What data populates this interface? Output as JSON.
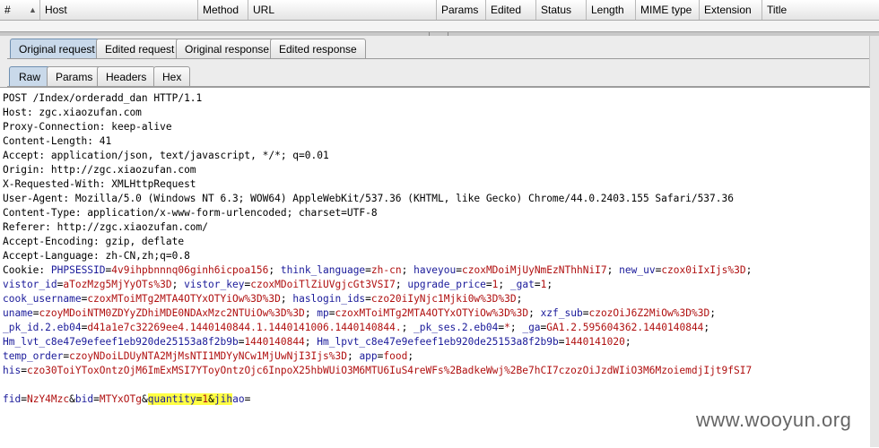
{
  "table": {
    "sort_icon": "sort-up-icon",
    "columns": [
      "#",
      "Host",
      "Method",
      "URL",
      "Params",
      "Edited",
      "Status",
      "Length",
      "MIME type",
      "Extension",
      "Title"
    ]
  },
  "outer_tabs": [
    "Original request",
    "Edited request",
    "Original response",
    "Edited response"
  ],
  "inner_tabs": [
    "Raw",
    "Params",
    "Headers",
    "Hex"
  ],
  "request": {
    "request_line": "POST /Index/orderadd_dan HTTP/1.1",
    "host": "Host: zgc.xiaozufan.com",
    "proxy_connection": "Proxy-Connection: keep-alive",
    "content_length": "Content-Length: 41",
    "accept": "Accept: application/json, text/javascript, */*; q=0.01",
    "origin": "Origin: http://zgc.xiaozufan.com",
    "x_requested_with": "X-Requested-With: XMLHttpRequest",
    "user_agent": "User-Agent: Mozilla/5.0 (Windows NT 6.3; WOW64) AppleWebKit/537.36 (KHTML, like Gecko) Chrome/44.0.2403.155 Safari/537.36",
    "content_type": "Content-Type: application/x-www-form-urlencoded; charset=UTF-8",
    "referer": "Referer: http://zgc.xiaozufan.com/",
    "accept_encoding": "Accept-Encoding: gzip, deflate",
    "accept_language": "Accept-Language: zh-CN,zh;q=0.8",
    "cookie_prefix": "Cookie: ",
    "cookies": [
      [
        [
          "PHPSESSID",
          "4v9ihpbnnnq06ginh6icpoa156"
        ],
        [
          "think_language",
          "zh-cn"
        ],
        [
          "haveyou",
          "czoxMDoiMjUyNmEzNThhNiI7"
        ],
        [
          "new_uv",
          "czox0iIxIjs%3D"
        ]
      ],
      [
        [
          "vistor_id",
          "aTozMzg5MjYyOTs%3D"
        ],
        [
          "vistor_key",
          "czoxMDoiTlZiUVgjcGt3VSI7"
        ],
        [
          "upgrade_price",
          "1"
        ],
        [
          "_gat",
          "1"
        ]
      ],
      [
        [
          "cook_username",
          "czoxMToiMTg2MTA4OTYxOTYiOw%3D%3D"
        ],
        [
          "haslogin_ids",
          "czo20iIyNjc1Mjki0w%3D%3D"
        ]
      ],
      [
        [
          "uname",
          "czoyMDoiNTM0ZDYyZDhiMDE0NDAxMzc2NTUiOw%3D%3D"
        ],
        [
          "mp",
          "czoxMToiMTg2MTA4OTYxOTYiOw%3D%3D"
        ],
        [
          "xzf_sub",
          "czozOiJ6Z2MiOw%3D%3D"
        ]
      ],
      [
        [
          "_pk_id.2.eb04",
          "d41a1e7c32269ee4.1440140844.1.1440141006.1440140844."
        ],
        [
          "_pk_ses.2.eb04",
          "*"
        ],
        [
          "_ga",
          "GA1.2.595604362.1440140844"
        ]
      ],
      [
        [
          "Hm_lvt_c8e47e9efeef1eb920de25153a8f2b9b",
          "1440140844"
        ],
        [
          "Hm_lpvt_c8e47e9efeef1eb920de25153a8f2b9b",
          "1440141020"
        ]
      ],
      [
        [
          "temp_order",
          "czoyNDoiLDUyNTA2MjMsNTI1MDYyNCw1MjUwNjI3Ijs%3D"
        ],
        [
          "app",
          "food"
        ]
      ],
      [
        [
          "his",
          "czo30ToiYToxOntzOjM6ImExMSI7YToyOntzOjc6InpoX25hbWUiO3M6MTU6IuS4reWFs%2BadkeWwj%2Be7hCI7czozOiJzdWIiO3M6MzoiemdjIjt9fSI7"
        ]
      ]
    ],
    "body": {
      "pre": [
        [
          "fid",
          "NzY4Mzc"
        ],
        [
          "bid",
          "MTYxOTg"
        ]
      ],
      "hl_key": "quantity",
      "hl_val": "1",
      "post_key": "jihao",
      "post_val": ""
    }
  },
  "watermark": "www.wooyun.org"
}
